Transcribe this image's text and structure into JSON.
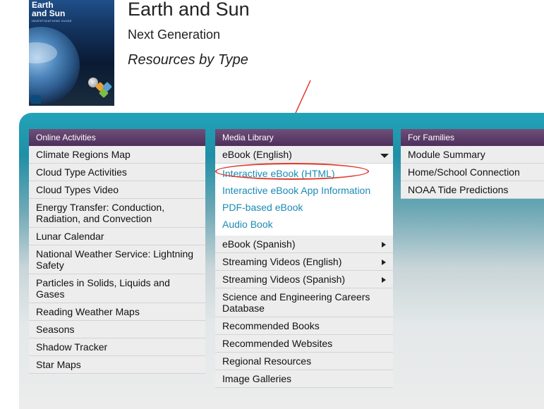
{
  "header": {
    "cover": {
      "title": "Earth\nand Sun",
      "subtitle": "INVESTIGATIONS GUIDE",
      "brand": "FOSS"
    },
    "title": "Earth and Sun",
    "subtitle": "Next Generation",
    "section": "Resources by Type"
  },
  "columns": {
    "online": {
      "heading": "Online Activities",
      "items": [
        "Climate Regions Map",
        "Cloud Type Activities",
        "Cloud Types Video",
        "Energy Transfer: Conduction, Radiation, and Convection",
        "Lunar Calendar",
        "National Weather Service: Lightning Safety",
        "Particles in Solids, Liquids and Gases",
        "Reading Weather Maps",
        "Seasons",
        "Shadow Tracker",
        "Star Maps"
      ]
    },
    "media": {
      "heading": "Media Library",
      "expanded": {
        "label": "eBook (English)",
        "links": [
          "Interactive eBook (HTML)",
          "Interactive eBook App Information",
          "PDF-based eBook",
          "Audio Book"
        ]
      },
      "items": [
        {
          "label": "eBook (Spanish)",
          "has_submenu": true
        },
        {
          "label": "Streaming Videos (English)",
          "has_submenu": true
        },
        {
          "label": "Streaming Videos (Spanish)",
          "has_submenu": true
        },
        {
          "label": "Science and Engineering Careers Database",
          "has_submenu": false
        },
        {
          "label": "Recommended Books",
          "has_submenu": false
        },
        {
          "label": "Recommended Websites",
          "has_submenu": false
        },
        {
          "label": "Regional Resources",
          "has_submenu": false
        },
        {
          "label": "Image Galleries",
          "has_submenu": false
        }
      ]
    },
    "families": {
      "heading": "For Families",
      "items": [
        "Module Summary",
        "Home/School Connection",
        "NOAA Tide Predictions"
      ]
    }
  },
  "colors": {
    "teal": "#1f8fa6",
    "purple": "#4e2f5c",
    "link": "#1a8bb5",
    "annotation": "#e03a2d"
  }
}
